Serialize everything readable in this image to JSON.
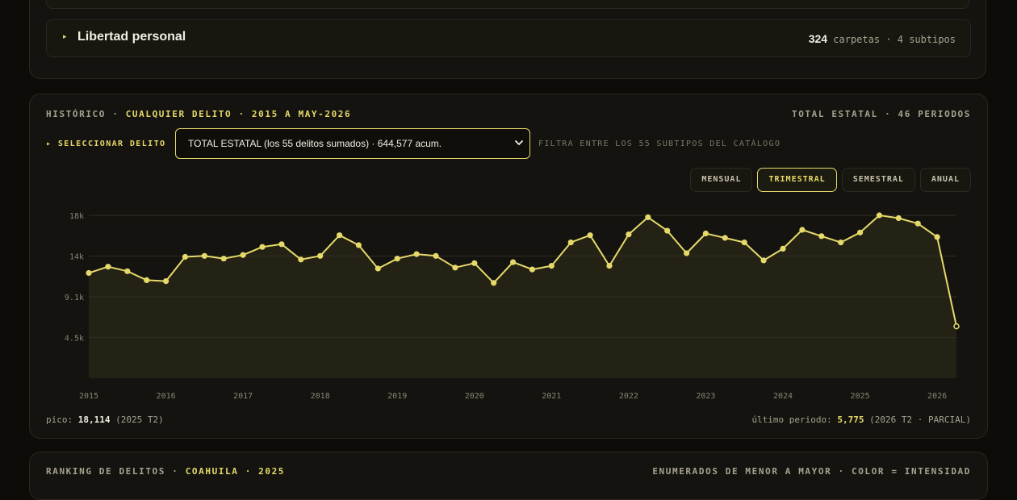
{
  "crime_row": {
    "name": "Libertad personal",
    "count": "324",
    "meta": "carpetas · 4 subtipos"
  },
  "header": {
    "left_prefix": "HISTÓRICO ·",
    "left_highlight": "CUALQUIER DELITO · 2015 A MAY-2026",
    "right": "TOTAL ESTATAL · 46 PERIODOS"
  },
  "selector": {
    "label": "▸ SELECCIONAR DELITO",
    "value": "TOTAL ESTATAL (los 55 delitos sumados) · 644,577 acum.",
    "hint": "FILTRA ENTRE LOS 55 SUBTIPOS DEL CATÁLOGO"
  },
  "tabs": [
    {
      "label": "MENSUAL",
      "active": false
    },
    {
      "label": "TRIMESTRAL",
      "active": true
    },
    {
      "label": "SEMESTRAL",
      "active": false
    },
    {
      "label": "ANUAL",
      "active": false
    }
  ],
  "footer": {
    "peak_label": "pico:",
    "peak_value": "18,114",
    "peak_period": "(2025 T2)",
    "last_label": "último periodo:",
    "last_value": "5,775",
    "last_period": "(2026 T2 · PARCIAL)"
  },
  "bottom_card": {
    "left_prefix": "RANKING DE DELITOS ·",
    "left_highlight": "COAHUILA · 2025",
    "right": "ENUMERADOS DE MENOR A MAYOR · COLOR = INTENSIDAD"
  },
  "colors": {
    "accent": "#e6d96a",
    "background": "#0d0c09",
    "card": "#14130f",
    "area_fill": "#2a2817"
  },
  "chart_data": {
    "type": "area",
    "x_tick_labels": [
      "2015",
      "2016",
      "2017",
      "2018",
      "2019",
      "2020",
      "2021",
      "2022",
      "2023",
      "2024",
      "2025",
      "2026"
    ],
    "y_tick_labels": [
      "18k",
      "14k",
      "9.1k",
      "4.5k"
    ],
    "y_ticks": [
      18114,
      13585,
      9057,
      4528
    ],
    "ylim": [
      0,
      18114
    ],
    "grid": true,
    "series": [
      {
        "values": [
          11700,
          12400,
          11900,
          10900,
          10800,
          13500,
          13600,
          13300,
          13700,
          14600,
          14900,
          13200,
          13600,
          15900,
          14800,
          12200,
          13300,
          13800,
          13600,
          12300,
          12800,
          10600,
          12900,
          12100,
          12500,
          15100,
          15900,
          12500,
          16000,
          17900,
          16400,
          13900,
          16100,
          15600,
          15100,
          13100,
          14400,
          16500,
          15800,
          15100,
          16200,
          18114,
          17800,
          17200,
          15700,
          5775
        ]
      }
    ],
    "last_point_partial": true
  }
}
